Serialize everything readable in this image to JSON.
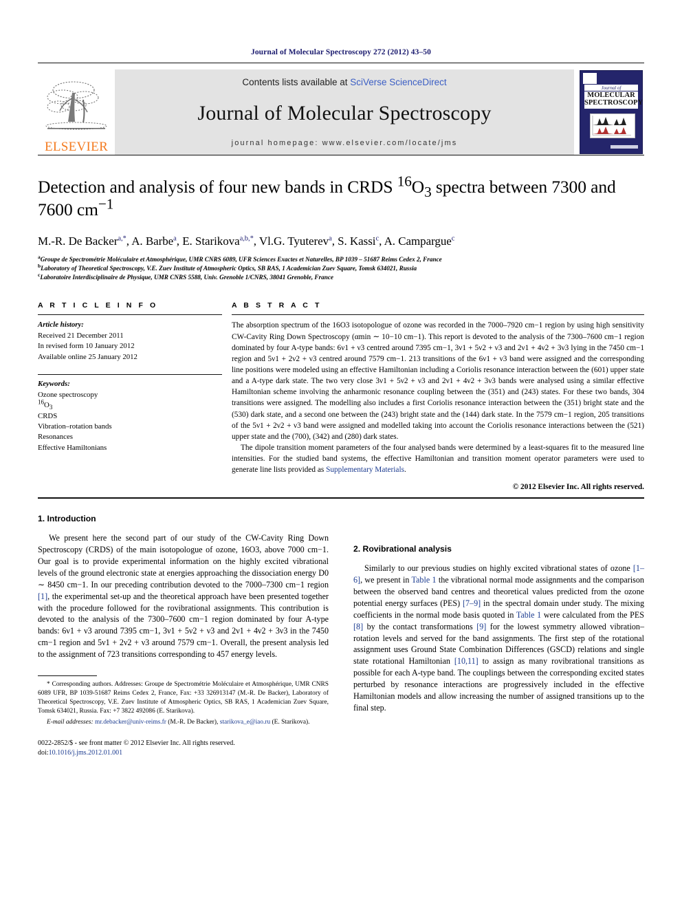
{
  "running_head": "Journal of Molecular Spectroscopy 272 (2012) 43–50",
  "masthead": {
    "contents_prefix": "Contents lists available at ",
    "sciencedirect": "SciVerse ScienceDirect",
    "journal_title": "Journal of Molecular Spectroscopy",
    "homepage": "journal homepage: www.elsevier.com/locate/jms",
    "publisher": "ELSEVIER",
    "cover": {
      "journal_of": "Journal of",
      "line1": "MOLECULAR",
      "line2": "SPECTROSCOPY"
    },
    "accent_link_color": "#3b5ec4",
    "elsevier_orange": "#F47B20",
    "cover_navy": "#24256b"
  },
  "article": {
    "title_line1": "Detection and analysis of four new bands in CRDS ",
    "title_iso_sup": "16",
    "title_iso_base": "O",
    "title_iso_sub": "3",
    "title_line1_end": " spectra between 7300",
    "title_line2_a": "and 7600 cm",
    "title_line2_sup": "−1",
    "authors_plain": "M.-R. De Backer, A. Barbe, E. Starikova, Vl.G. Tyuterev, S. Kassi, A. Campargue",
    "authors": [
      {
        "name": "M.-R. De Backer",
        "sup": "a,*"
      },
      {
        "name": "A. Barbe",
        "sup": "a"
      },
      {
        "name": "E. Starikova",
        "sup": "a,b,*"
      },
      {
        "name": "Vl.G. Tyuterev",
        "sup": "a"
      },
      {
        "name": "S. Kassi",
        "sup": "c"
      },
      {
        "name": "A. Campargue",
        "sup": "c"
      }
    ],
    "affiliations": [
      {
        "mark": "a",
        "text": "Groupe de Spectrométrie Moléculaire et Atmosphérique, UMR CNRS 6089, UFR Sciences Exactes et Naturelles, BP 1039 – 51687 Reims Cedex 2, France"
      },
      {
        "mark": "b",
        "text": "Laboratory of Theoretical Spectroscopy, V.E. Zuev Institute of Atmospheric Optics, SB RAS, 1 Academician Zuev Square, Tomsk 634021, Russia"
      },
      {
        "mark": "c",
        "text": "Laboratoire Interdisciplinaire de Physique, UMR CNRS 5588, Univ. Grenoble 1/CNRS, 38041 Grenoble, France"
      }
    ]
  },
  "info": {
    "heading": "A R T I C L E   I N F O",
    "history_label": "Article history:",
    "history": [
      "Received 21 December 2011",
      "In revised form 10 January 2012",
      "Available online 25 January 2012"
    ],
    "keywords_label": "Keywords:",
    "keywords": [
      "Ozone spectroscopy",
      "16O3",
      "CRDS",
      "Vibration–rotation bands",
      "Resonances",
      "Effective Hamiltonians"
    ]
  },
  "abstract": {
    "heading": "A B S T R A C T",
    "paragraph1": "The absorption spectrum of the 16O3 isotopologue of ozone was recorded in the 7000–7920 cm−1 region by using high sensitivity CW-Cavity Ring Down Spectroscopy (αmin ∼ 10−10 cm−1). This report is devoted to the analysis of the 7300–7600 cm−1 region dominated by four A-type bands: 6ν1 + ν3 centred around 7395 cm−1, 3ν1 + 5ν2 + ν3 and 2ν1 + 4ν2 + 3ν3 lying in the 7450 cm−1 region and 5ν1 + 2ν2 + ν3 centred around 7579 cm−1. 213 transitions of the 6ν1 + ν3 band were assigned and the corresponding line positions were modeled using an effective Hamiltonian including a Coriolis resonance interaction between the (601) upper state and a A-type dark state. The two very close 3ν1 + 5ν2 + ν3 and 2ν1 + 4ν2 + 3ν3 bands were analysed using a similar effective Hamiltonian scheme involving the anharmonic resonance coupling between the (351) and (243) states. For these two bands, 304 transitions were assigned. The modelling also includes a first Coriolis resonance interaction between the (351) bright state and the (530) dark state, and a second one between the (243) bright state and the (144) dark state. In the 7579 cm−1 region, 205 transitions of the 5ν1 + 2ν2 + ν3 band were assigned and modelled taking into account the Coriolis resonance interactions between the (521) upper state and the (700), (342) and (280) dark states.",
    "paragraph2_a": "The dipole transition moment parameters of the four analysed bands were determined by a least-squares fit to the measured line intensities. For the studied band systems, the effective Hamiltonian and transition moment operator parameters were used to generate line lists provided as ",
    "paragraph2_link": "Supplementary Materials",
    "paragraph2_end": ".",
    "copyright": "© 2012 Elsevier Inc. All rights reserved."
  },
  "sections": {
    "intro_heading": "1. Introduction",
    "intro_paragraph_a": "We present here the second part of our study of the CW-Cavity Ring Down Spectroscopy (CRDS) of the main isotopologue of ozone, 16O3, above 7000 cm−1. Our goal is to provide experimental information on the highly excited vibrational levels of the ground electronic state at energies approaching the dissociation energy D0 ∼ 8450 cm−1. In our preceding contribution devoted to the 7000–7300 cm−1 region ",
    "intro_ref1": "[1]",
    "intro_paragraph_b": ", the experimental set-up and the theoretical approach have been presented together with the procedure followed for the rovibrational assignments. This contribution is devoted to the analysis of the 7300–7600 cm−1 region dominated by four A-type bands: 6ν1 + ν3 around 7395 cm−1, 3ν1 + 5ν2 + ν3 and 2ν1 + 4ν2 + 3ν3 in the 7450 cm−1 region and 5ν1 + 2ν2 + ν3 around 7579 cm−1. Overall, the present analysis led to the assignment of 723 transitions corresponding to 457 energy levels.",
    "rovib_heading": "2. Rovibrational analysis",
    "rovib_a": "Similarly to our previous studies on highly excited vibrational states of ozone ",
    "rovib_ref16": "[1–6]",
    "rovib_b": ", we present in ",
    "rovib_table1a": "Table 1",
    "rovib_c": " the vibrational normal mode assignments and the comparison between the observed band centres and theoretical values predicted from the ozone potential energy surfaces (PES) ",
    "rovib_ref79": "[7–9]",
    "rovib_d": " in the spectral domain under study. The mixing coefficients in the normal mode basis quoted in ",
    "rovib_table1b": "Table 1",
    "rovib_e": " were calculated from the PES ",
    "rovib_ref8": "[8]",
    "rovib_f": " by the contact transformations ",
    "rovib_ref9": "[9]",
    "rovib_g": " for the lowest symmetry allowed vibration–rotation levels and served for the band assignments. The first step of the rotational assignment uses Ground State Combination Differences (GSCD) relations and single state rotational Hamiltonian ",
    "rovib_ref1011": "[10,11]",
    "rovib_h": " to assign as many rovibrational transitions as possible for each A-type band. The couplings between the corresponding excited states perturbed by resonance interactions are progressively included in the effective Hamiltonian models and allow increasing the number of assigned transitions up to the final step."
  },
  "footnotes": {
    "corresponding": "* Corresponding authors. Addresses: Groupe de Spectrométrie Moléculaire et Atmosphérique, UMR CNRS 6089 UFR, BP 1039-51687 Reims Cedex 2, France, Fax: +33 326913147 (M.-R. De Backer), Laboratory of Theoretical Spectroscopy, V.E. Zuev Institute of Atmospheric Optics, SB RAS, 1 Academician Zuev Square, Tomsk 634021, Russia. Fax: +7 3822 492086 (E. Starikova).",
    "email_label": "E-mail addresses:",
    "email1": "mr.debacker@univ-reims.fr",
    "email1_owner": " (M.-R. De Backer), ",
    "email2": "starikova_e@iao.ru",
    "email2_owner": " (E. Starikova).",
    "issn_line": "0022-2852/$ - see front matter © 2012 Elsevier Inc. All rights reserved.",
    "doi_label": "doi:",
    "doi_value": "10.1016/j.jms.2012.01.001"
  }
}
